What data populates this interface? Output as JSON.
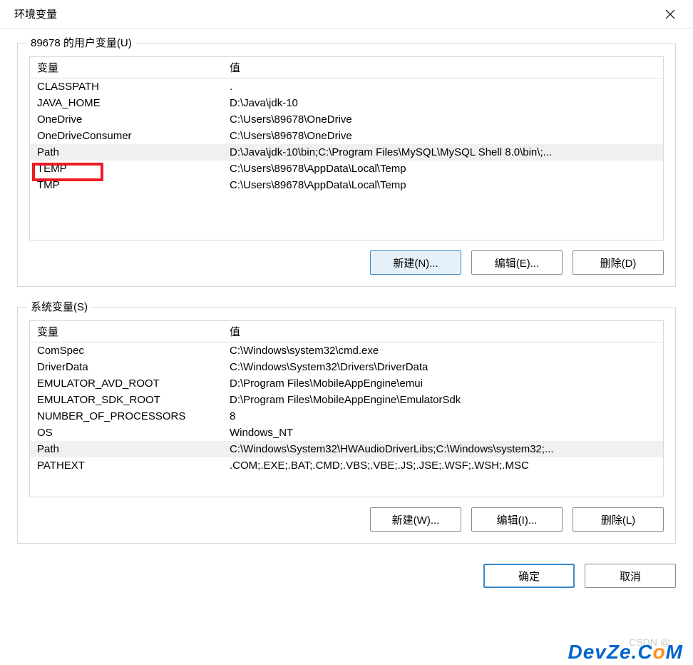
{
  "titlebar": {
    "title": "环境变量"
  },
  "userVars": {
    "groupLabel": "89678 的用户变量(U)",
    "columns": {
      "name": "变量",
      "value": "值"
    },
    "rows": [
      {
        "name": "CLASSPATH",
        "value": "."
      },
      {
        "name": "JAVA_HOME",
        "value": "D:\\Java\\jdk-10"
      },
      {
        "name": "OneDrive",
        "value": "C:\\Users\\89678\\OneDrive"
      },
      {
        "name": "OneDriveConsumer",
        "value": "C:\\Users\\89678\\OneDrive"
      },
      {
        "name": "Path",
        "value": "D:\\Java\\jdk-10\\bin;C:\\Program Files\\MySQL\\MySQL Shell 8.0\\bin\\;...",
        "selected": true
      },
      {
        "name": "TEMP",
        "value": "C:\\Users\\89678\\AppData\\Local\\Temp"
      },
      {
        "name": "TMP",
        "value": "C:\\Users\\89678\\AppData\\Local\\Temp"
      }
    ],
    "buttons": {
      "new": "新建(N)...",
      "edit": "编辑(E)...",
      "delete": "删除(D)"
    }
  },
  "sysVars": {
    "groupLabel": "系统变量(S)",
    "columns": {
      "name": "变量",
      "value": "值"
    },
    "rows": [
      {
        "name": "ComSpec",
        "value": "C:\\Windows\\system32\\cmd.exe"
      },
      {
        "name": "DriverData",
        "value": "C:\\Windows\\System32\\Drivers\\DriverData"
      },
      {
        "name": "EMULATOR_AVD_ROOT",
        "value": "D:\\Program Files\\MobileAppEngine\\emui"
      },
      {
        "name": "EMULATOR_SDK_ROOT",
        "value": "D:\\Program Files\\MobileAppEngine\\EmulatorSdk"
      },
      {
        "name": "NUMBER_OF_PROCESSORS",
        "value": "8"
      },
      {
        "name": "OS",
        "value": "Windows_NT"
      },
      {
        "name": "Path",
        "value": "C:\\Windows\\System32\\HWAudioDriverLibs;C:\\Windows\\system32;...",
        "selected": true
      },
      {
        "name": "PATHEXT",
        "value": ".COM;.EXE;.BAT;.CMD;.VBS;.VBE;.JS;.JSE;.WSF;.WSH;.MSC"
      }
    ],
    "buttons": {
      "new": "新建(W)...",
      "edit": "编辑(I)...",
      "delete": "删除(L)"
    }
  },
  "dialogButtons": {
    "ok": "确定",
    "cancel": "取消"
  },
  "watermark": {
    "csdn": "CSDN @",
    "devze": "DevZe.CoM"
  }
}
